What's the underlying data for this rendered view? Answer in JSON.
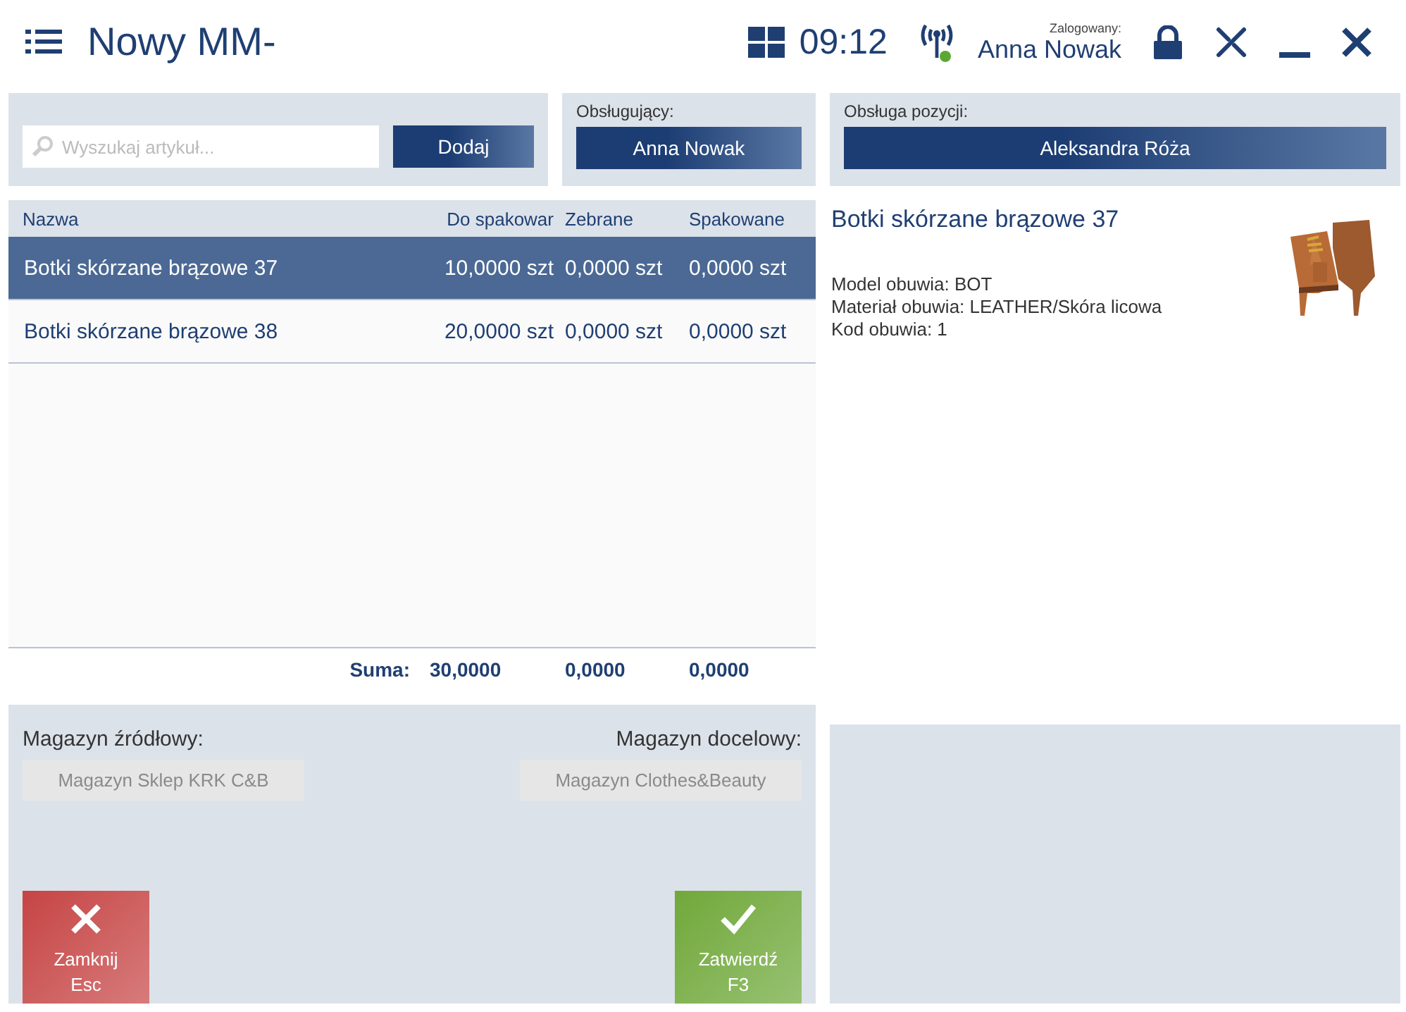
{
  "header": {
    "title": "Nowy MM-",
    "time": "09:12",
    "logged_label": "Zalogowany:",
    "user": "Anna Nowak"
  },
  "search": {
    "placeholder": "Wyszukaj artykuł...",
    "add_button": "Dodaj"
  },
  "serving": {
    "label": "Obsługujący:",
    "value": "Anna Nowak"
  },
  "item_service": {
    "label": "Obsługa pozycji:",
    "value": "Aleksandra Róża"
  },
  "table": {
    "columns": [
      "Nazwa",
      "Do spakowar",
      "Zebrane",
      "Spakowane"
    ],
    "rows": [
      {
        "selected": true,
        "cells": [
          "Botki skórzane brązowe 37",
          "10,0000 szt",
          "0,0000 szt",
          "0,0000 szt"
        ]
      },
      {
        "selected": false,
        "cells": [
          "Botki skórzane brązowe 38",
          "20,0000 szt",
          "0,0000 szt",
          "0,0000 szt"
        ]
      }
    ],
    "sum_label": "Suma:",
    "sums": [
      "30,0000",
      "0,0000",
      "0,0000"
    ]
  },
  "details": {
    "title": "Botki skórzane brązowe 37",
    "image": {
      "kind": "picture"
    },
    "attributes": [
      "Model obuwia: BOT",
      "Materiał obuwia: LEATHER/Skóra licowa",
      "Kod obuwia: 1"
    ]
  },
  "warehouses": {
    "source_label": "Magazyn źródłowy:",
    "source": {
      "value": "Magazyn Sklep KRK C&B",
      "disabled": true
    },
    "target_label": "Magazyn docelowy:",
    "target": {
      "value": "Magazyn Clothes&Beauty",
      "disabled": true
    }
  },
  "actions": [
    {
      "kind": "close",
      "label": "Zamknij",
      "key": "Esc"
    },
    {
      "kind": "confirm",
      "label": "Zatwierdź",
      "key": "F3"
    }
  ]
}
